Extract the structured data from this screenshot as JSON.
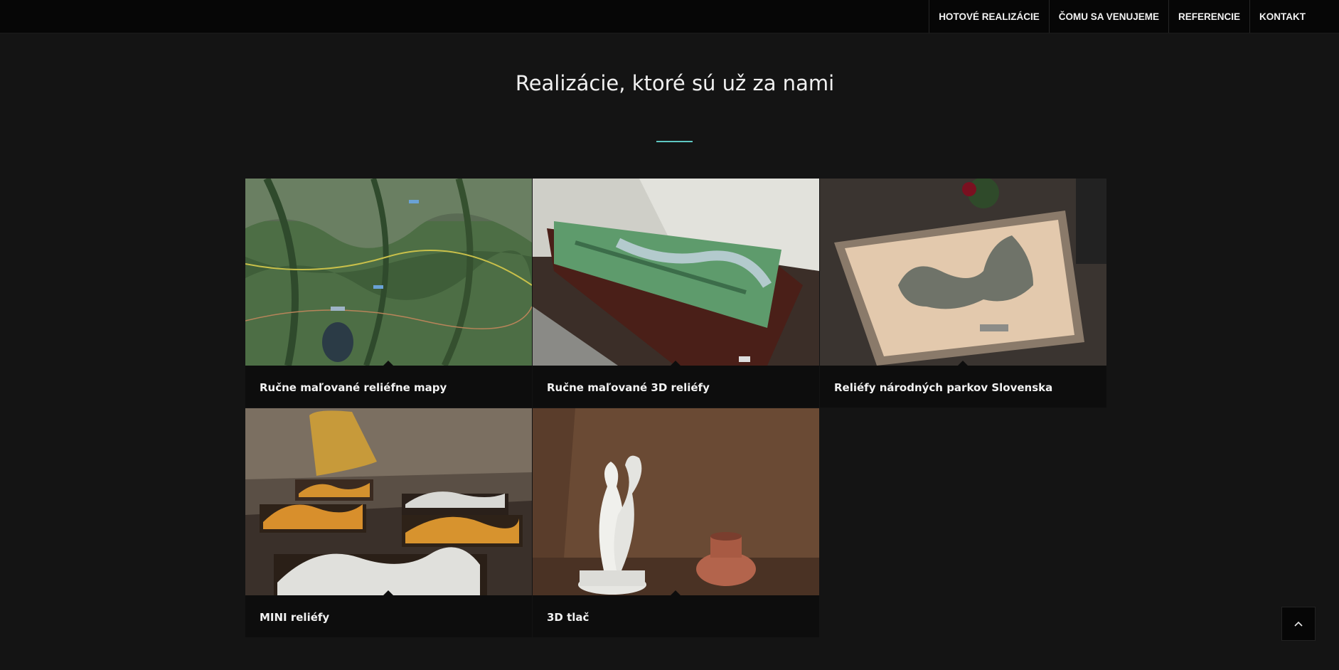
{
  "nav": {
    "items": [
      {
        "label": "HOTOVÉ REALIZÁCIE"
      },
      {
        "label": "ČOMU SA VENUJEME"
      },
      {
        "label": "REFERENCIE"
      },
      {
        "label": "KONTAKT"
      }
    ]
  },
  "section": {
    "title": "Realizácie, ktoré sú už za nami"
  },
  "portfolio": {
    "items": [
      {
        "label": "Ručne maľované reliéfne mapy"
      },
      {
        "label": "Ručne maľované 3D reliéfy"
      },
      {
        "label": "Reliéfy národných parkov Slovenska"
      },
      {
        "label": "MINI reliéfy"
      },
      {
        "label": "3D tlač"
      }
    ]
  },
  "colors": {
    "page_background": "#141414",
    "topbar_background": "#060606",
    "accent": "#5ec7c2",
    "text": "#f2f2f2"
  },
  "icons": {
    "back_to_top": "chevron-up-icon"
  }
}
